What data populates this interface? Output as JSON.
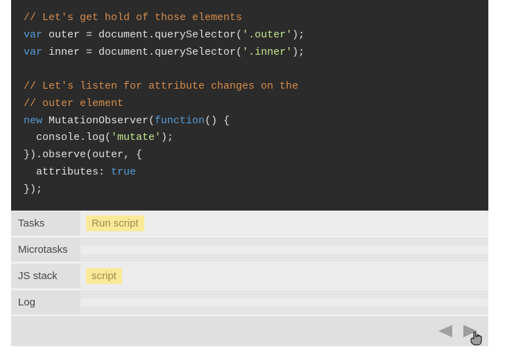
{
  "code": {
    "lines": [
      {
        "segments": [
          {
            "cls": "c-comment",
            "t": "// Let's get hold of those elements"
          }
        ]
      },
      {
        "segments": [
          {
            "cls": "c-keyword",
            "t": "var"
          },
          {
            "cls": "c-plain",
            "t": " outer = document.querySelector("
          },
          {
            "cls": "c-string",
            "t": "'.outer'"
          },
          {
            "cls": "c-plain",
            "t": ");"
          }
        ]
      },
      {
        "segments": [
          {
            "cls": "c-keyword",
            "t": "var"
          },
          {
            "cls": "c-plain",
            "t": " inner = document.querySelector("
          },
          {
            "cls": "c-string",
            "t": "'.inner'"
          },
          {
            "cls": "c-plain",
            "t": ");"
          }
        ]
      },
      {
        "segments": [
          {
            "cls": "c-plain",
            "t": " "
          }
        ]
      },
      {
        "segments": [
          {
            "cls": "c-comment",
            "t": "// Let's listen for attribute changes on the"
          }
        ]
      },
      {
        "segments": [
          {
            "cls": "c-comment",
            "t": "// outer element"
          }
        ]
      },
      {
        "segments": [
          {
            "cls": "c-keyword",
            "t": "new"
          },
          {
            "cls": "c-plain",
            "t": " MutationObserver("
          },
          {
            "cls": "c-keyword",
            "t": "function"
          },
          {
            "cls": "c-plain",
            "t": "() {"
          }
        ]
      },
      {
        "segments": [
          {
            "cls": "c-plain",
            "t": "  console.log("
          },
          {
            "cls": "c-string",
            "t": "'mutate'"
          },
          {
            "cls": "c-plain",
            "t": ");"
          }
        ]
      },
      {
        "segments": [
          {
            "cls": "c-plain",
            "t": "}).observe(outer, {"
          }
        ]
      },
      {
        "segments": [
          {
            "cls": "c-plain",
            "t": "  attributes: "
          },
          {
            "cls": "c-bool",
            "t": "true"
          }
        ]
      },
      {
        "segments": [
          {
            "cls": "c-plain",
            "t": "});"
          }
        ]
      }
    ]
  },
  "rows": {
    "tasks": {
      "label": "Tasks",
      "items": [
        "Run script"
      ]
    },
    "microtasks": {
      "label": "Microtasks",
      "items": []
    },
    "jsstack": {
      "label": "JS stack",
      "items": [
        "script"
      ]
    },
    "log": {
      "label": "Log",
      "items": []
    }
  },
  "nav": {
    "prev": "previous-step",
    "next": "next-step"
  }
}
